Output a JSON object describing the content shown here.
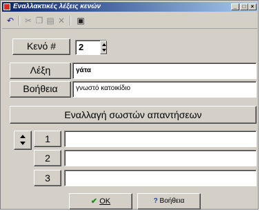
{
  "window": {
    "title": "Εναλλακτικές λέξεις κενών"
  },
  "title_buttons": {
    "minimize": "_",
    "maximize": "□",
    "close": "×"
  },
  "toolbar": {
    "icons": [
      "undo-icon",
      "cut-icon",
      "copy-icon",
      "paste-icon",
      "delete-icon",
      "image-icon"
    ]
  },
  "form": {
    "blank_label": "Κενό #",
    "blank_value": "2",
    "word_label": "Λέξη",
    "word_value": "γάτα",
    "hint_label": "Βοήθεια",
    "hint_value": "γνωστό κατοικίδιο",
    "swap_label": "Εναλλαγή σωστών απαντήσεων"
  },
  "answers": [
    {
      "number": "1",
      "value": ""
    },
    {
      "number": "2",
      "value": ""
    },
    {
      "number": "3",
      "value": ""
    }
  ],
  "footer": {
    "ok_label": "ΟΚ",
    "help_label": "Βοήθεια"
  }
}
